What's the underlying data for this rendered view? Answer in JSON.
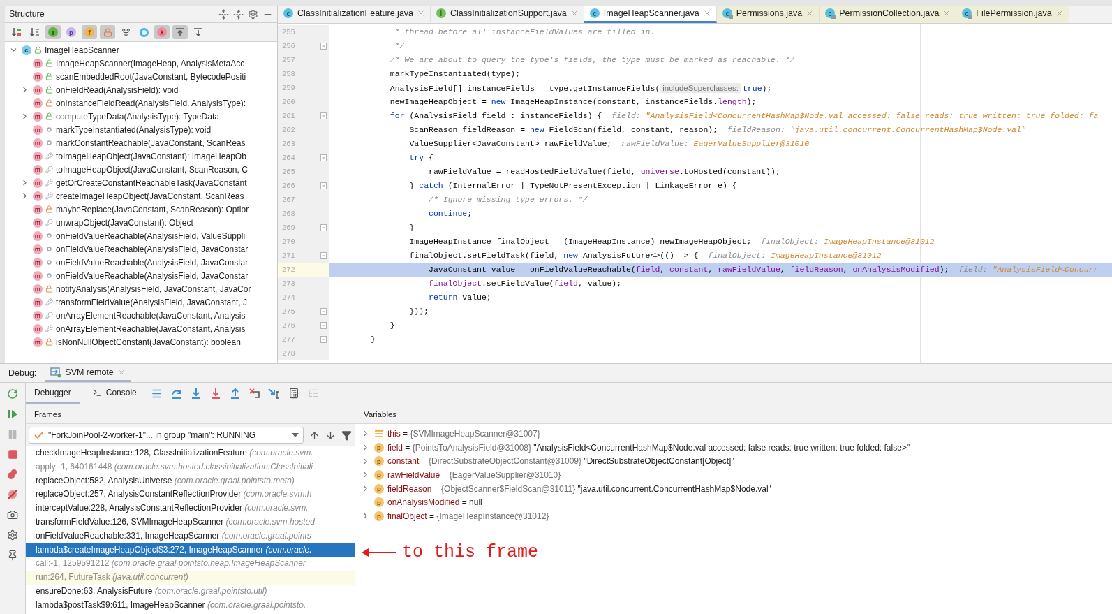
{
  "structure": {
    "title": "Structure",
    "toolbar": [
      {
        "kind": "sort-visibility",
        "on": false
      },
      {
        "kind": "sort-alpha",
        "on": false
      },
      {
        "kind": "inherited",
        "glyph": "I",
        "on": true
      },
      {
        "kind": "properties",
        "glyph": "p",
        "on": false
      },
      {
        "kind": "fields",
        "glyph": "f",
        "on": true
      },
      {
        "kind": "non-public",
        "on": true
      },
      {
        "kind": "fork",
        "on": false
      },
      {
        "kind": "anonymous",
        "on": false
      },
      {
        "kind": "lambdas",
        "glyph": "λ",
        "on": true
      },
      {
        "kind": "autoscroll-to",
        "on": true
      },
      {
        "kind": "autoscroll-from",
        "on": false
      }
    ],
    "root": {
      "label": "ImageHeapScanner",
      "badge": "c",
      "kind": "public",
      "expanded": true,
      "children": [
        {
          "label": "ImageHeapScanner(ImageHeap, AnalysisMetaAcc",
          "badge": "m",
          "kind": "public",
          "collapsible": false
        },
        {
          "label": "scanEmbeddedRoot(JavaConstant, BytecodePositi",
          "badge": "m",
          "kind": "public",
          "collapsible": false
        },
        {
          "label": "onFieldRead(AnalysisField): void",
          "badge": "m",
          "kind": "public",
          "collapsible": true
        },
        {
          "label": "onInstanceFieldRead(AnalysisField, AnalysisType):",
          "badge": "m",
          "kind": "private",
          "collapsible": false
        },
        {
          "label": "computeTypeData(AnalysisType): TypeData",
          "badge": "m",
          "kind": "public",
          "collapsible": true
        },
        {
          "label": "markTypeInstantiated(AnalysisType): void",
          "badge": "m",
          "kind": "package",
          "collapsible": false
        },
        {
          "label": "markConstantReachable(JavaConstant, ScanReas",
          "badge": "m",
          "kind": "package",
          "collapsible": false
        },
        {
          "label": "toImageHeapObject(JavaConstant): ImageHeapOb",
          "badge": "m",
          "kind": "protected",
          "collapsible": false
        },
        {
          "label": "toImageHeapObject(JavaConstant, ScanReason, C",
          "badge": "m",
          "kind": "protected",
          "collapsible": false
        },
        {
          "label": "getOrCreateConstantReachableTask(JavaConstant",
          "badge": "m",
          "kind": "protected",
          "collapsible": true
        },
        {
          "label": "createImageHeapObject(JavaConstant, ScanReas",
          "badge": "m",
          "kind": "protected",
          "collapsible": true
        },
        {
          "label": "maybeReplace(JavaConstant, ScanReason): Optior",
          "badge": "m",
          "kind": "private",
          "collapsible": false
        },
        {
          "label": "unwrapObject(JavaConstant): Object",
          "badge": "m",
          "kind": "protected",
          "collapsible": false
        },
        {
          "label": "onFieldValueReachable(AnalysisField, ValueSuppli",
          "badge": "m",
          "kind": "package",
          "collapsible": false
        },
        {
          "label": "onFieldValueReachable(AnalysisField, JavaConstar",
          "badge": "m",
          "kind": "package",
          "collapsible": false
        },
        {
          "label": "onFieldValueReachable(AnalysisField, JavaConstar",
          "badge": "m",
          "kind": "package",
          "collapsible": false
        },
        {
          "label": "onFieldValueReachable(AnalysisField, JavaConstar",
          "badge": "m",
          "kind": "package",
          "collapsible": false
        },
        {
          "label": "notifyAnalysis(AnalysisField, JavaConstant, JavaCor",
          "badge": "m",
          "kind": "private",
          "collapsible": false
        },
        {
          "label": "transformFieldValue(AnalysisField, JavaConstant, J",
          "badge": "m",
          "kind": "protected",
          "collapsible": false
        },
        {
          "label": "onArrayElementReachable(JavaConstant, Analysis",
          "badge": "m",
          "kind": "protected",
          "collapsible": false
        },
        {
          "label": "onArrayElementReachable(JavaConstant, Analysis",
          "badge": "m",
          "kind": "protected",
          "collapsible": false
        },
        {
          "label": "isNonNullObjectConstant(JavaConstant): boolean",
          "badge": "m",
          "kind": "private",
          "collapsible": false
        }
      ]
    }
  },
  "editor": {
    "tabs": [
      {
        "label": "ClassInitializationFeature.java",
        "kind": "class",
        "badge": "c",
        "selected": false
      },
      {
        "label": "ClassInitializationSupport.java",
        "kind": "interface",
        "badge": "I",
        "selected": false
      },
      {
        "label": "ImageHeapScanner.java",
        "kind": "class",
        "badge": "c",
        "selected": true
      },
      {
        "label": "Permissions.java",
        "kind": "library",
        "badge": "c",
        "selected": false
      },
      {
        "label": "PermissionCollection.java",
        "kind": "library",
        "badge": "c",
        "selected": false
      },
      {
        "label": "FilePermission.java",
        "kind": "library",
        "badge": "c",
        "selected": false
      }
    ],
    "lines": [
      {
        "number": "255",
        "fold": false,
        "current": false,
        "segments": [
          {
            "kind": "comment",
            "text": "             * thread before all instanceFieldValues are filled in."
          }
        ]
      },
      {
        "number": "256",
        "fold": true,
        "current": false,
        "segments": [
          {
            "kind": "comment",
            "text": "             */"
          }
        ]
      },
      {
        "number": "257",
        "fold": false,
        "current": false,
        "segments": [
          {
            "kind": "comment",
            "text": "            /* We are about to query the type's fields, the type must be marked as reachable. */"
          }
        ]
      },
      {
        "number": "258",
        "fold": false,
        "current": false,
        "segments": [
          {
            "kind": "plain",
            "text": "            markTypeInstantiated(type);"
          }
        ]
      },
      {
        "number": "259",
        "fold": false,
        "current": false,
        "segments": [
          {
            "kind": "plain",
            "text": "            AnalysisField[] instanceFields = type.getInstanceFields("
          },
          {
            "kind": "inlay",
            "text": "includeSuperclasses:"
          },
          {
            "kind": "keyword",
            "text": "true"
          },
          {
            "kind": "plain",
            "text": ");"
          }
        ]
      },
      {
        "number": "260",
        "fold": false,
        "current": false,
        "segments": [
          {
            "kind": "plain",
            "text": "            newImageHeapObject = "
          },
          {
            "kind": "keyword",
            "text": "new"
          },
          {
            "kind": "plain",
            "text": " ImageHeapInstance(constant, instanceFields."
          },
          {
            "kind": "field",
            "text": "length"
          },
          {
            "kind": "plain",
            "text": ");"
          }
        ]
      },
      {
        "number": "261",
        "fold": true,
        "current": false,
        "segments": [
          {
            "kind": "keyword",
            "text": "            for"
          },
          {
            "kind": "plain",
            "text": " (AnalysisField field : instanceFields) {  "
          },
          {
            "kind": "hint",
            "text": "field: "
          },
          {
            "kind": "value",
            "text": "\"AnalysisField<ConcurrentHashMap$Node.val accessed: false reads: true written: true folded: fa"
          }
        ]
      },
      {
        "number": "262",
        "fold": false,
        "current": false,
        "segments": [
          {
            "kind": "plain",
            "text": "                ScanReason fieldReason = "
          },
          {
            "kind": "keyword",
            "text": "new"
          },
          {
            "kind": "plain",
            "text": " FieldScan(field, constant, reason);  "
          },
          {
            "kind": "hint",
            "text": "fieldReason: "
          },
          {
            "kind": "value",
            "text": "\"java.util.concurrent.ConcurrentHashMap$Node.val\""
          }
        ]
      },
      {
        "number": "263",
        "fold": false,
        "current": false,
        "segments": [
          {
            "kind": "plain",
            "text": "                ValueSupplier<JavaConstant> rawFieldValue;  "
          },
          {
            "kind": "hint",
            "text": "rawFieldValue: "
          },
          {
            "kind": "value",
            "text": "EagerValueSupplier@31010"
          }
        ]
      },
      {
        "number": "264",
        "fold": true,
        "current": false,
        "segments": [
          {
            "kind": "keyword",
            "text": "                try"
          },
          {
            "kind": "plain",
            "text": " {"
          }
        ]
      },
      {
        "number": "265",
        "fold": false,
        "current": false,
        "segments": [
          {
            "kind": "plain",
            "text": "                    rawFieldValue = readHostedFieldValue(field, "
          },
          {
            "kind": "field",
            "text": "universe"
          },
          {
            "kind": "plain",
            "text": ".toHosted(constant));"
          }
        ]
      },
      {
        "number": "266",
        "fold": true,
        "current": false,
        "segments": [
          {
            "kind": "plain",
            "text": "                } "
          },
          {
            "kind": "keyword",
            "text": "catch"
          },
          {
            "kind": "plain",
            "text": " (InternalError | TypeNotPresentException | LinkageError e) {"
          }
        ]
      },
      {
        "number": "267",
        "fold": false,
        "current": false,
        "segments": [
          {
            "kind": "comment",
            "text": "                    /* Ignore missing type errors. */"
          }
        ]
      },
      {
        "number": "268",
        "fold": false,
        "current": false,
        "segments": [
          {
            "kind": "keyword",
            "text": "                    continue"
          },
          {
            "kind": "plain",
            "text": ";"
          }
        ]
      },
      {
        "number": "269",
        "fold": true,
        "current": false,
        "segments": [
          {
            "kind": "plain",
            "text": "                }"
          }
        ]
      },
      {
        "number": "270",
        "fold": false,
        "current": false,
        "segments": [
          {
            "kind": "plain",
            "text": "                ImageHeapInstance finalObject = (ImageHeapInstance) newImageHeapObject;  "
          },
          {
            "kind": "hint",
            "text": "finalObject: "
          },
          {
            "kind": "value",
            "text": "ImageHeapInstance@31012"
          }
        ]
      },
      {
        "number": "271",
        "fold": true,
        "current": false,
        "segments": [
          {
            "kind": "plain",
            "text": "                finalObject.setFieldTask(field, "
          },
          {
            "kind": "keyword",
            "text": "new"
          },
          {
            "kind": "plain",
            "text": " AnalysisFuture<>(() -> {  "
          },
          {
            "kind": "hint",
            "text": "finalObject: "
          },
          {
            "kind": "value",
            "text": "ImageHeapInstance@31012"
          }
        ]
      },
      {
        "number": "272",
        "fold": false,
        "current": true,
        "segments": [
          {
            "kind": "plain",
            "text": "                    JavaConstant value = onFieldValueReachable("
          },
          {
            "kind": "field",
            "text": "field"
          },
          {
            "kind": "plain",
            "text": ", "
          },
          {
            "kind": "field",
            "text": "constant"
          },
          {
            "kind": "plain",
            "text": ", "
          },
          {
            "kind": "field",
            "text": "rawFieldValue"
          },
          {
            "kind": "plain",
            "text": ", "
          },
          {
            "kind": "field",
            "text": "fieldReason"
          },
          {
            "kind": "plain",
            "text": ", "
          },
          {
            "kind": "field",
            "text": "onAnalysisModified"
          },
          {
            "kind": "plain",
            "text": ");  "
          },
          {
            "kind": "hint",
            "text": "field: "
          },
          {
            "kind": "value",
            "text": "\"AnalysisField<Concurr"
          }
        ]
      },
      {
        "number": "273",
        "fold": false,
        "current": false,
        "segments": [
          {
            "kind": "field",
            "text": "                    finalObject"
          },
          {
            "kind": "plain",
            "text": ".setFieldValue("
          },
          {
            "kind": "field",
            "text": "field"
          },
          {
            "kind": "plain",
            "text": ", value);"
          }
        ]
      },
      {
        "number": "274",
        "fold": false,
        "current": false,
        "segments": [
          {
            "kind": "keyword",
            "text": "                    return"
          },
          {
            "kind": "plain",
            "text": " value;"
          }
        ]
      },
      {
        "number": "275",
        "fold": true,
        "current": false,
        "segments": [
          {
            "kind": "plain",
            "text": "                }));"
          }
        ]
      },
      {
        "number": "276",
        "fold": true,
        "current": false,
        "segments": [
          {
            "kind": "plain",
            "text": "            }"
          }
        ]
      },
      {
        "number": "277",
        "fold": true,
        "current": false,
        "segments": [
          {
            "kind": "plain",
            "text": "        }"
          }
        ]
      },
      {
        "number": "278",
        "fold": false,
        "current": false
      }
    ]
  },
  "debug": {
    "label": "Debug:",
    "session": {
      "label": "SVM remote",
      "selected": true
    },
    "side_actions": [
      {
        "kind": "rerun",
        "disabled": false
      },
      {
        "kind": "resume",
        "disabled": false
      },
      {
        "kind": "pause",
        "disabled": true
      },
      {
        "kind": "stop",
        "disabled": false
      },
      {
        "kind": "breakpoints",
        "disabled": false
      },
      {
        "kind": "mute",
        "disabled": false
      },
      {
        "kind": "snapshot",
        "disabled": false
      },
      {
        "kind": "settings",
        "disabled": false
      },
      {
        "kind": "pin",
        "disabled": false
      }
    ],
    "tabs": [
      {
        "label": "Debugger",
        "kind": "debugger",
        "selected": true
      },
      {
        "label": "Console",
        "kind": "console",
        "selected": false
      }
    ],
    "actions": [
      {
        "kind": "layout",
        "disabled": false
      },
      {
        "kind": "step-over",
        "disabled": false
      },
      {
        "kind": "step-into",
        "disabled": false
      },
      {
        "kind": "force-step-into",
        "disabled": false
      },
      {
        "kind": "step-out",
        "disabled": false
      },
      {
        "kind": "drop-frame",
        "disabled": false
      },
      {
        "kind": "run-to-cursor",
        "disabled": false
      },
      {
        "kind": "evaluate",
        "disabled": false
      },
      {
        "kind": "trace",
        "disabled": true
      }
    ],
    "frames": {
      "title": "Frames",
      "thread": "\"ForkJoinPool-2-worker-1\"... in group \"main\": RUNNING",
      "items": [
        {
          "method": "checkImageHeapInstance:128, ClassInitializationFeature",
          "package": "(com.oracle.svm.",
          "kind": "project",
          "selected": false
        },
        {
          "method": "apply:-1, 640161448",
          "package": "(com.oracle.svm.hosted.classinitialization.ClassInitiali",
          "kind": "synthetic",
          "selected": false
        },
        {
          "method": "replaceObject:582, AnalysisUniverse",
          "package": "(com.oracle.graal.pointsto.meta)",
          "kind": "project",
          "selected": false
        },
        {
          "method": "replaceObject:257, AnalysisConstantReflectionProvider",
          "package": "(com.oracle.svm.h",
          "kind": "project",
          "selected": false
        },
        {
          "method": "interceptValue:228, AnalysisConstantReflectionProvider",
          "package": "(com.oracle.svm.",
          "kind": "project",
          "selected": false
        },
        {
          "method": "transformFieldValue:126, SVMImageHeapScanner",
          "package": "(com.oracle.svm.hosted",
          "kind": "project",
          "selected": false
        },
        {
          "method": "onFieldValueReachable:331, ImageHeapScanner",
          "package": "(com.oracle.graal.points",
          "kind": "project",
          "selected": false
        },
        {
          "method": "lambda$createImageHeapObject$3:272, ImageHeapScanner",
          "package": "(com.oracle.",
          "kind": "project",
          "selected": true
        },
        {
          "method": "call:-1, 1259591212",
          "package": "(com.oracle.graal.pointsto.heap.ImageHeapScanner",
          "kind": "synthetic",
          "selected": false
        },
        {
          "method": "run:264, FutureTask",
          "package": "(java.util.concurrent)",
          "kind": "library",
          "selected": false
        },
        {
          "method": "ensureDone:63, AnalysisFuture",
          "package": "(com.oracle.graal.pointsto.util)",
          "kind": "project",
          "selected": false
        },
        {
          "method": "lambda$postTask$9:611, ImageHeapScanner",
          "package": "(com.oracle.graal.pointsto.",
          "kind": "project",
          "selected": false
        }
      ]
    },
    "variables": {
      "title": "Variables",
      "items": [
        {
          "kind": "object",
          "name": "this",
          "op": "=",
          "type": "{SVMImageHeapScanner@31007}",
          "expandable": true
        },
        {
          "kind": "param",
          "badge": "p",
          "name": "field",
          "op": "=",
          "type": "{PointsToAnalysisField@31008}",
          "value": "\"AnalysisField<ConcurrentHashMap$Node.val accessed: false reads: true written: true folded: false>\"",
          "expandable": true
        },
        {
          "kind": "param",
          "badge": "p",
          "name": "constant",
          "op": "=",
          "type": "{DirectSubstrateObjectConstant@31009}",
          "value": "\"DirectSubstrateObjectConstant[Object]\"",
          "expandable": true
        },
        {
          "kind": "param",
          "badge": "p",
          "name": "rawFieldValue",
          "op": "=",
          "type": "{EagerValueSupplier@31010}",
          "expandable": true
        },
        {
          "kind": "param",
          "badge": "p",
          "name": "fieldReason",
          "op": "=",
          "type": "{ObjectScanner$FieldScan@31011}",
          "value": "\"java.util.concurrent.ConcurrentHashMap$Node.val\"",
          "expandable": true
        },
        {
          "kind": "param",
          "badge": "p",
          "name": "onAnalysisModified",
          "op": "=",
          "value": "null",
          "expandable": false
        },
        {
          "kind": "param",
          "badge": "p",
          "name": "finalObject",
          "op": "=",
          "type": "{ImageHeapInstance@31012}",
          "expandable": true
        }
      ]
    }
  },
  "annotation": {
    "text": "to this frame"
  }
}
